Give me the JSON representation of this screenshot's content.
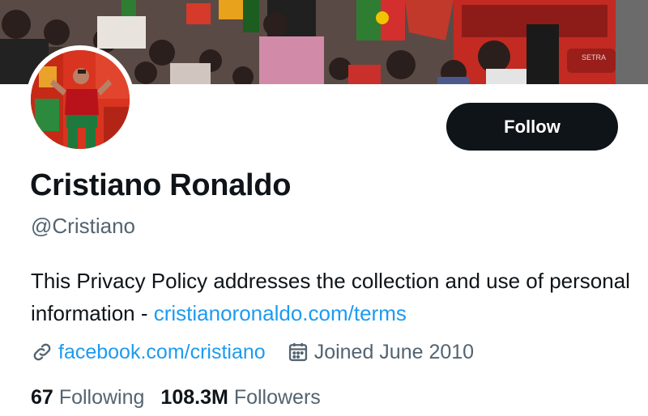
{
  "profile": {
    "name": "Cristiano Ronaldo",
    "handle": "@Cristiano",
    "bio_text": "This Privacy Policy addresses the collection and use of personal information - ",
    "bio_link": "cristianoronaldo.com/terms",
    "website": "facebook.com/cristiano",
    "joined": "Joined June 2010",
    "following_count": "67",
    "following_label": "Following",
    "followers_count": "108.3M",
    "followers_label": "Followers"
  },
  "actions": {
    "follow_label": "Follow"
  },
  "banner": {
    "bus_text": "SETRA"
  },
  "icons": {
    "link": "link-icon",
    "calendar": "calendar-icon"
  },
  "colors": {
    "text_primary": "#0f1419",
    "text_secondary": "#536471",
    "link": "#1d9bf0",
    "button_bg": "#0f1419"
  }
}
